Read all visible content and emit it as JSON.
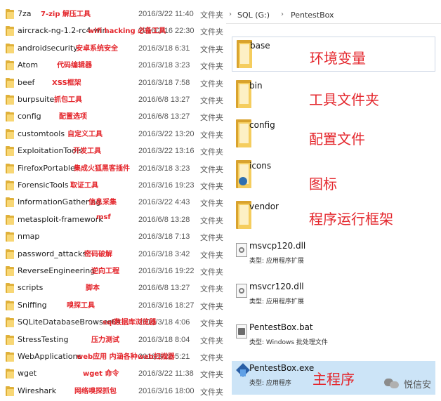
{
  "left_pane": {
    "rows": [
      {
        "name": "7za",
        "date": "2016/3/22 11:40",
        "type": "文件夹",
        "note": "7-zip 解压工具"
      },
      {
        "name": "aircrack-ng-1.2-rc4-win",
        "date": "2016/3/16 22:30",
        "type": "文件夹",
        "note": "wifi hacking 必备工具"
      },
      {
        "name": "androidsecurity",
        "date": "2016/3/18 6:31",
        "type": "文件夹",
        "note": "安卓系统安全"
      },
      {
        "name": "Atom",
        "date": "2016/3/18 3:23",
        "type": "文件夹",
        "note": "代码编辑器"
      },
      {
        "name": "beef",
        "date": "2016/3/18 7:58",
        "type": "文件夹",
        "note": "XSS框架"
      },
      {
        "name": "burpsuite",
        "date": "2016/6/8 13:27",
        "type": "文件夹",
        "note": "抓包工具"
      },
      {
        "name": "config",
        "date": "2016/6/8 13:27",
        "type": "文件夹",
        "note": "配置选项"
      },
      {
        "name": "customtools",
        "date": "2016/3/22 13:20",
        "type": "文件夹",
        "note": "自定义工具"
      },
      {
        "name": "ExploitationTools",
        "date": "2016/3/22 13:16",
        "type": "文件夹",
        "note": "开发工具"
      },
      {
        "name": "FirefoxPortable",
        "date": "2016/3/18 3:23",
        "type": "文件夹",
        "note": "集成火狐黑客插件"
      },
      {
        "name": "ForensicTools",
        "date": "2016/3/16 19:23",
        "type": "文件夹",
        "note": "取证工具"
      },
      {
        "name": "InformationGathering",
        "date": "2016/3/22 4:43",
        "type": "文件夹",
        "note": "信息采集"
      },
      {
        "name": "metasploit-framework",
        "date": "2016/6/8 13:28",
        "type": "文件夹",
        "note": "msf"
      },
      {
        "name": "nmap",
        "date": "2016/3/18 7:13",
        "type": "文件夹",
        "note": ""
      },
      {
        "name": "password_attacks",
        "date": "2016/3/18 3:42",
        "type": "文件夹",
        "note": "密码破解"
      },
      {
        "name": "ReverseEngineering",
        "date": "2016/3/16 19:22",
        "type": "文件夹",
        "note": "逆向工程"
      },
      {
        "name": "scripts",
        "date": "2016/6/8 13:27",
        "type": "文件夹",
        "note": "脚本"
      },
      {
        "name": "Sniffing",
        "date": "2016/3/16 18:27",
        "type": "文件夹",
        "note": "嗅探工具"
      },
      {
        "name": "SQLiteDatabaseBrowser64",
        "date": "2016/3/18 4:06",
        "type": "文件夹",
        "note": "sql数据库浏览器"
      },
      {
        "name": "StressTesting",
        "date": "2016/3/18 8:04",
        "type": "文件夹",
        "note": "压力测试"
      },
      {
        "name": "WebApplications",
        "date": "2016/3/22 5:21",
        "type": "文件夹",
        "note": "web应用 内涵各种web扫描器"
      },
      {
        "name": "wget",
        "date": "2016/3/22 11:38",
        "type": "文件夹",
        "note": "wget 命令"
      },
      {
        "name": "Wireshark",
        "date": "2016/3/16 18:00",
        "type": "文件夹",
        "note": "网络嗅探抓包"
      }
    ]
  },
  "right_pane": {
    "breadcrumb": {
      "drive": "SQL (G:)",
      "folder": "PentestBox",
      "separator": "›"
    },
    "folders": [
      {
        "name": "base",
        "note": "环境变量"
      },
      {
        "name": "bin",
        "note": "工具文件夹"
      },
      {
        "name": "config",
        "note": "配置文件"
      },
      {
        "name": "icons",
        "note": "图标"
      },
      {
        "name": "vendor",
        "note": "程序运行框架"
      }
    ],
    "files": [
      {
        "name": "msvcp120.dll",
        "sub": "类型: 应用程序扩展",
        "note": ""
      },
      {
        "name": "msvcr120.dll",
        "sub": "类型: 应用程序扩展",
        "note": ""
      },
      {
        "name": "PentestBox.bat",
        "sub": "类型: Windows 批处理文件",
        "note": ""
      },
      {
        "name": "PentestBox.exe",
        "sub": "类型: 应用程序",
        "note": "主程序"
      }
    ]
  },
  "watermark": {
    "text": "悦信安"
  },
  "colors": {
    "annotation": "#e4262c",
    "folder": "#f5cd5e",
    "selection": "#cce4f7"
  }
}
